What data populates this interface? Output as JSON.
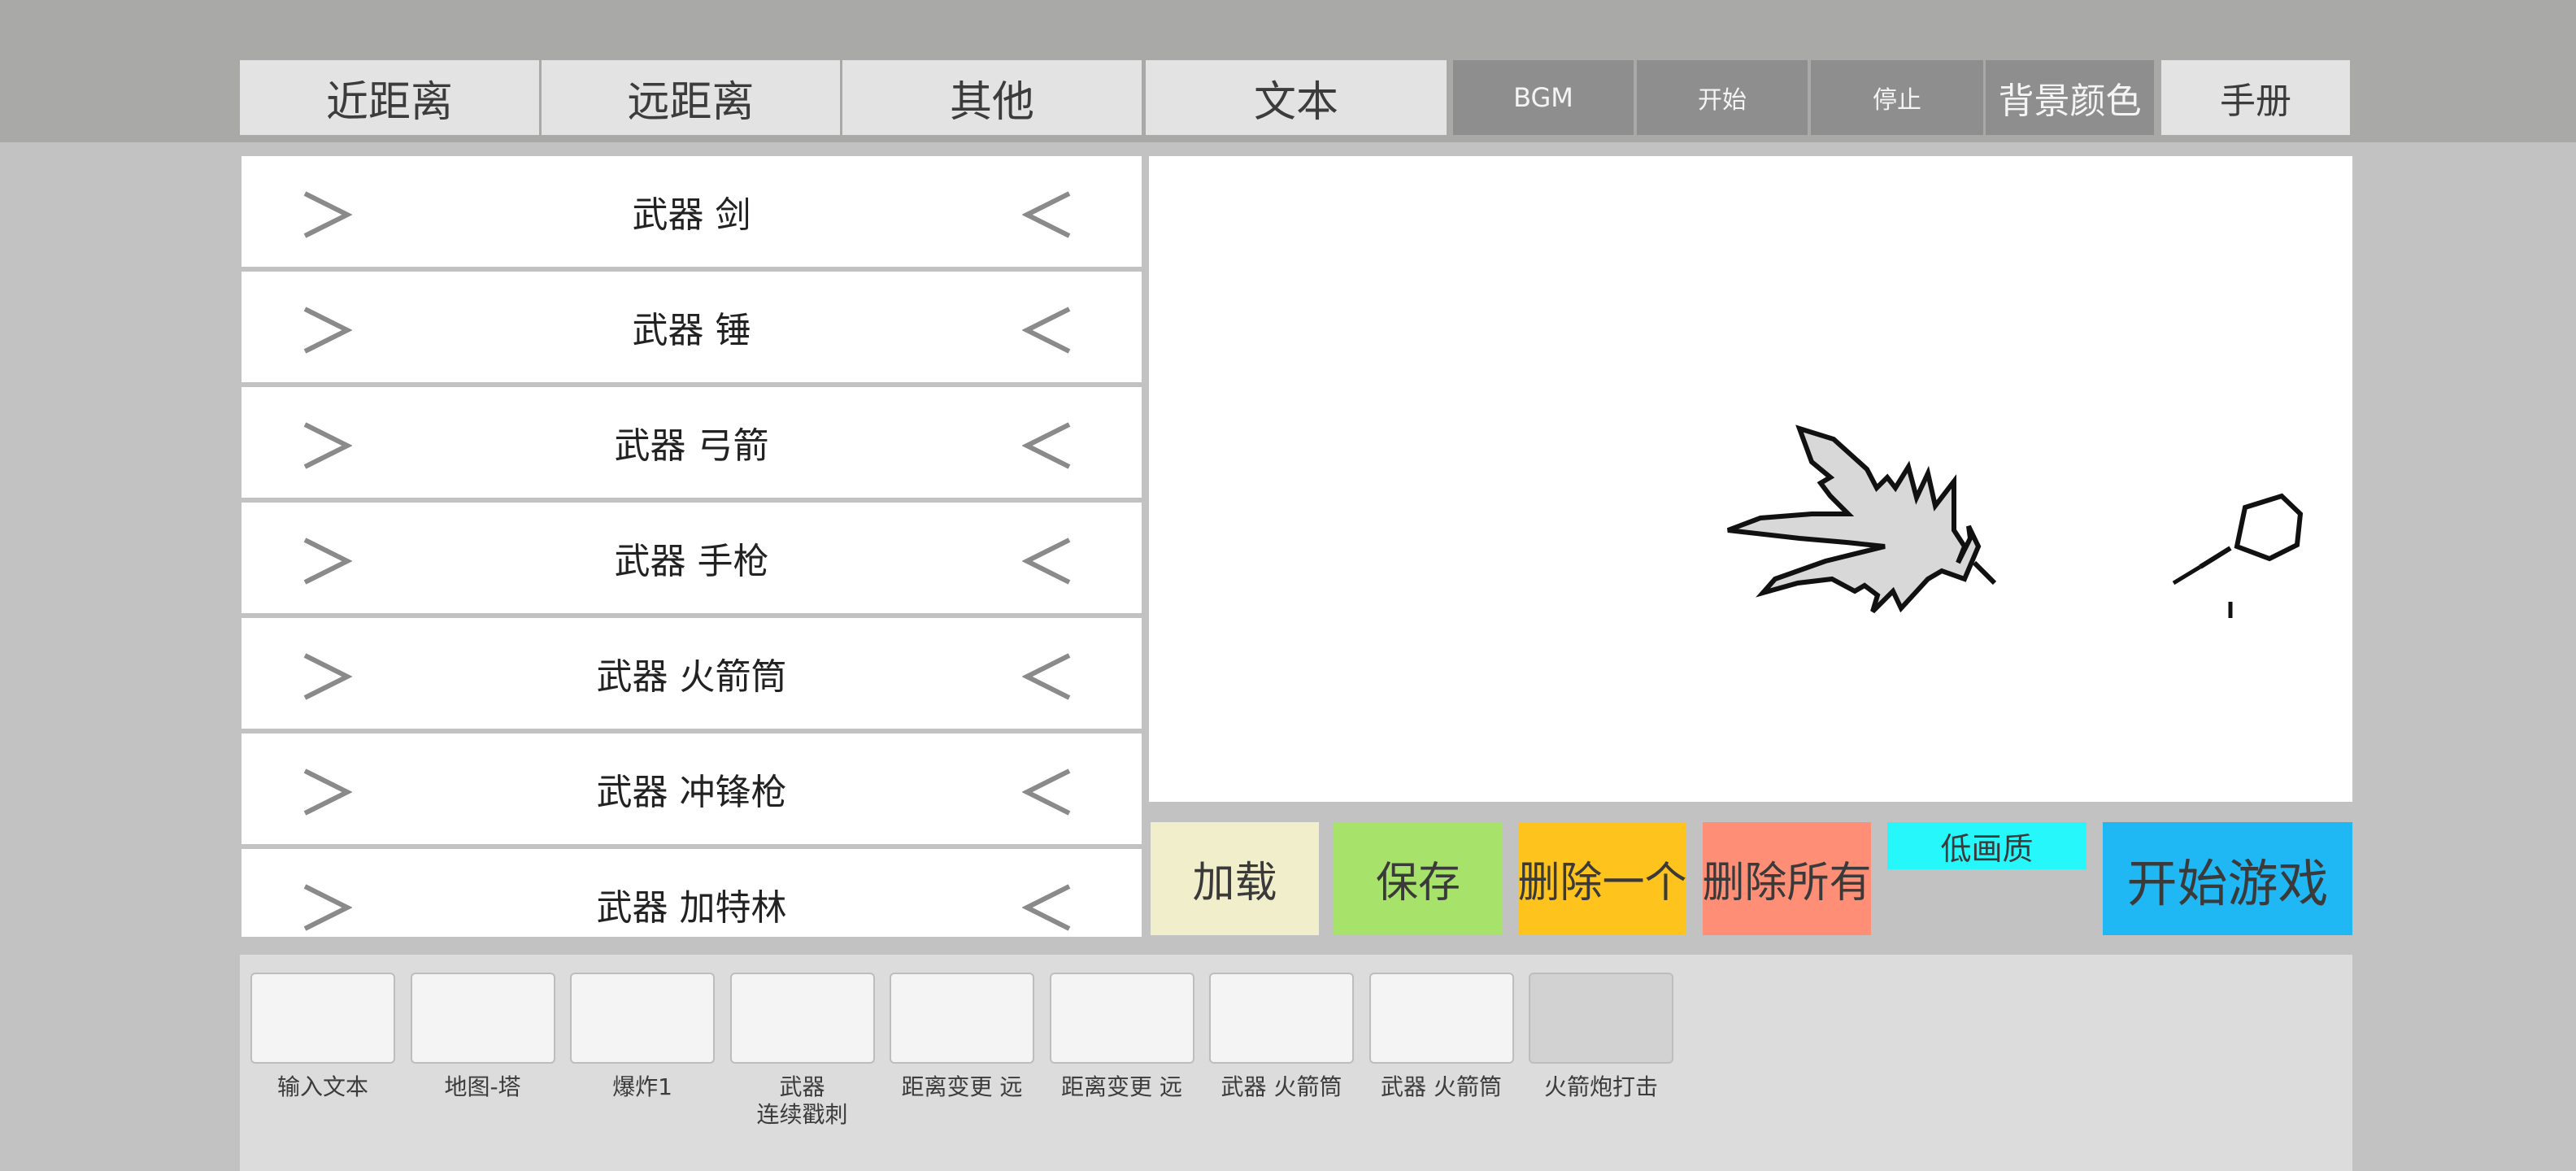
{
  "tabs": [
    "近距离",
    "远距离",
    "其他",
    "文本"
  ],
  "toolbar": {
    "bgm": "BGM",
    "start": "开始",
    "stop": "停止",
    "bg_color": "背景颜色",
    "manual": "手册"
  },
  "weapons": [
    "武器 剑",
    "武器 锤",
    "武器 弓箭",
    "武器 手枪",
    "武器 火箭筒",
    "武器 冲锋枪",
    "武器 加特林"
  ],
  "actions": {
    "load": "加载",
    "save": "保存",
    "delete_one": "删除一个",
    "delete_all": "删除所有",
    "low_quality": "低画质",
    "start_game": "开始游戏"
  },
  "sequence": [
    {
      "label": "输入文本"
    },
    {
      "label": "地图-塔"
    },
    {
      "label": "爆炸1"
    },
    {
      "label": "武器\n连续戳刺"
    },
    {
      "label": "距离变更 远"
    },
    {
      "label": "距离变更 远"
    },
    {
      "label": "武器 火箭筒"
    },
    {
      "label": "武器 火箭筒"
    },
    {
      "label": "火箭炮打击"
    }
  ],
  "colors": {
    "load": "#f1eecb",
    "save": "#a7e26b",
    "delete_one": "#ffc31d",
    "delete_all": "#fe8e75",
    "low_quality": "#26f7fb",
    "start_game": "#1fb7f4"
  },
  "icons": {
    "row_left": "chevron-right-icon",
    "row_right": "chevron-left-icon",
    "preview": "stickman-rocket-explosion"
  }
}
